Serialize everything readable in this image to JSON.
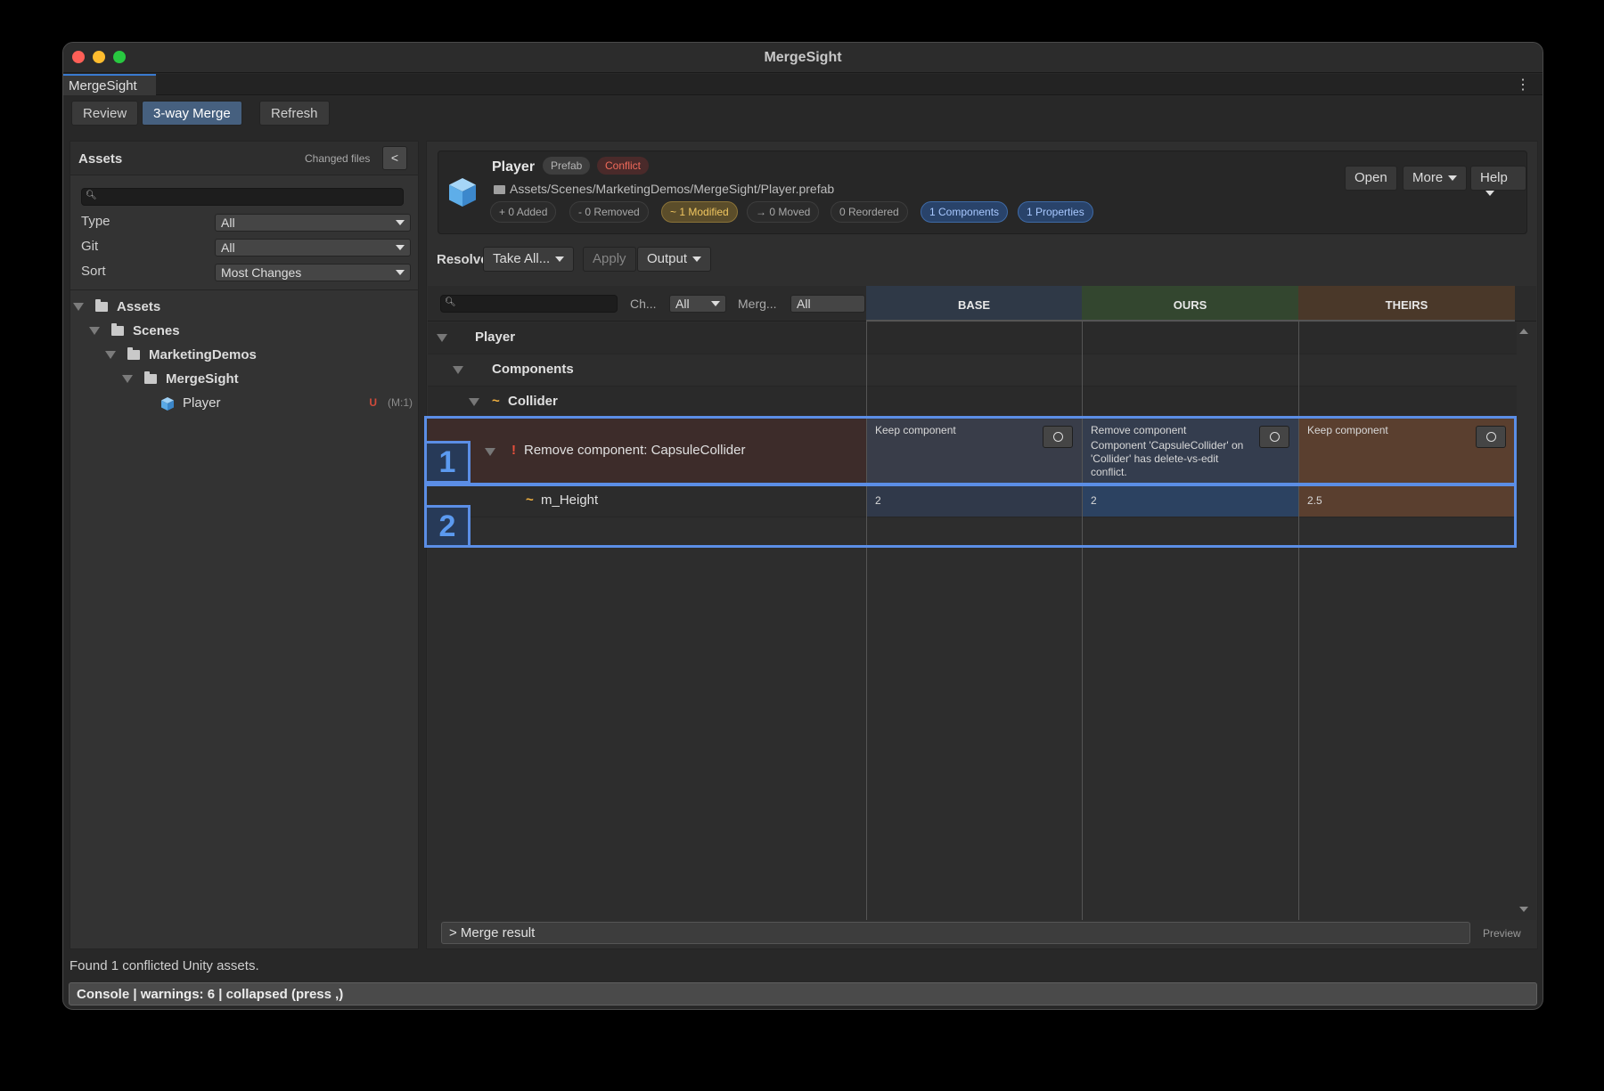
{
  "window": {
    "title": "MergeSight",
    "tab": "MergeSight",
    "traffic_colors": [
      "#ff5f57",
      "#febc2e",
      "#28c840"
    ]
  },
  "toolbar": {
    "review": "Review",
    "merge": "3-way Merge",
    "refresh": "Refresh"
  },
  "sidebar": {
    "title": "Assets",
    "changed_files": "Changed files",
    "collapse": "<",
    "filters": [
      {
        "label": "Type",
        "value": "All"
      },
      {
        "label": "Git",
        "value": "All"
      },
      {
        "label": "Sort",
        "value": "Most Changes"
      }
    ],
    "tree": [
      "Assets",
      "Scenes",
      "MarketingDemos",
      "MergeSight",
      "Player"
    ],
    "player_badge_u": "U",
    "player_badge_m": "(M:1)"
  },
  "asset": {
    "name": "Player",
    "tag_prefab": "Prefab",
    "tag_conflict": "Conflict",
    "path": "Assets/Scenes/MarketingDemos/MergeSight/Player.prefab",
    "stats": [
      "+ 0 Added",
      "- 0 Removed",
      "~ 1 Modified",
      "→ 0 Moved",
      "0 Reordered",
      "1 Components",
      "1 Properties"
    ],
    "buttons": {
      "open": "Open",
      "more": "More",
      "help": "Help"
    }
  },
  "resolve": {
    "label": "Resolve",
    "take_all": "Take All...",
    "apply": "Apply",
    "output": "Output"
  },
  "grid": {
    "ch_label": "Ch...",
    "ch_value": "All",
    "merge_label": "Merg...",
    "merge_value": "All",
    "columns": {
      "base": "BASE",
      "ours": "OURS",
      "theirs": "THEIRS"
    },
    "column_colors": {
      "base": "#2f3947",
      "ours": "#33462f",
      "theirs": "#4a3829"
    },
    "tree": {
      "player": "Player",
      "components": "Components",
      "collider_mark": "~",
      "collider": "Collider"
    },
    "conflict_row": {
      "mark": "!",
      "label": "Remove component: CapsuleCollider",
      "base": "Keep component",
      "ours": "Remove component",
      "ours_note": "Component 'CapsuleCollider' on 'Collider' has delete-vs-edit conflict.",
      "theirs": "Keep component"
    },
    "property_row": {
      "mark": "~",
      "label": "m_Height",
      "base": "2",
      "ours": "2",
      "theirs": "2.5"
    }
  },
  "highlights": {
    "one": "1",
    "two": "2"
  },
  "merge_result": "> Merge result",
  "preview": "Preview",
  "status": "Found 1 conflicted Unity assets.",
  "console": "Console | warnings: 6 | collapsed (press ,)"
}
